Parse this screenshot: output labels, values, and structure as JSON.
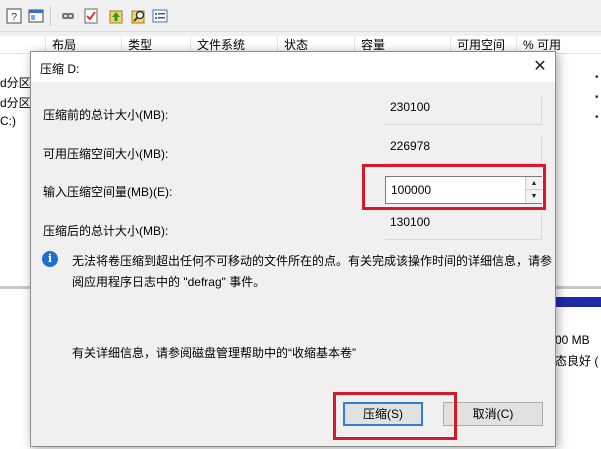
{
  "background": {
    "toolbar_icons": [
      "help-icon",
      "window-icon",
      "eye-icon",
      "checklist-icon",
      "up-arrow-icon",
      "search-icon",
      "properties-icon"
    ],
    "columns": [
      "布局",
      "类型",
      "文件系统",
      "状态",
      "容量",
      "可用空间",
      "% 可用"
    ],
    "left_fragments": [
      "d分区",
      "d分区",
      "C:)"
    ],
    "right_fragments": [
      "00 MB",
      "态良好 ("
    ]
  },
  "dialog": {
    "title": "压缩 D:",
    "close_glyph": "✕",
    "fields": {
      "total_before_label": "压缩前的总计大小(MB):",
      "total_before_value": "230100",
      "available_label": "可用压缩空间大小(MB):",
      "available_value": "226978",
      "amount_label": "输入压缩空间量(MB)(E):",
      "amount_value": "100000",
      "total_after_label": "压缩后的总计大小(MB):",
      "total_after_value": "130100"
    },
    "info_glyph": "i",
    "info_text": "无法将卷压缩到超出任何不可移动的文件所在的点。有关完成该操作时间的详细信息，请参阅应用程序日志中的 \"defrag\" 事件。",
    "help_text": "有关详细信息，请参阅磁盘管理帮助中的“收缩基本卷”",
    "shrink_button": "压缩(S)",
    "cancel_button": "取消(C)"
  },
  "colors": {
    "highlight_box": "#d7192c",
    "info_blue": "#1f6fd1",
    "focus_blue": "#2f7fd6"
  }
}
